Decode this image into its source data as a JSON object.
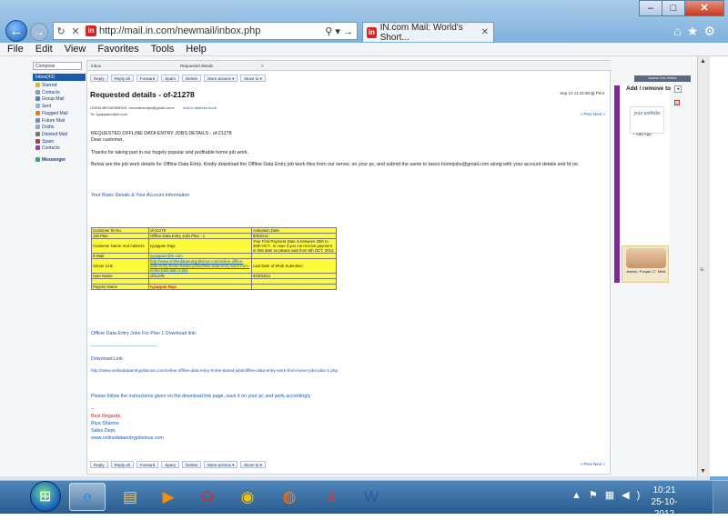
{
  "browser": {
    "url": "http://mail.in.com/newmail/inbox.php",
    "tab_title": "IN.com Mail: World's Short...",
    "menu": [
      "File",
      "Edit",
      "View",
      "Favorites",
      "Tools",
      "Help"
    ],
    "window_controls": [
      "–",
      "□",
      "✕"
    ]
  },
  "sidebar": {
    "compose": "Compose",
    "inbox": "Inbox(43)",
    "items": [
      "Starred",
      "Contacts",
      "Group Mail",
      "Sent",
      "Flagged Mail",
      "Future Mail",
      "Drafts",
      "Deleted Mail",
      "Spam",
      "Contacts",
      "Messenger"
    ]
  },
  "mail_tabs": {
    "inbox": "Inbox",
    "open_mail": "Requested details"
  },
  "toolbar": {
    "buttons": [
      "Reply",
      "Reply all",
      "Forward",
      "Spam",
      "Delete",
      "More actions ▾",
      "Move to ▾"
    ]
  },
  "mail": {
    "subject": "Requested details - of-21278",
    "date": "Sep 12 11:33:38",
    "print": "Print",
    "from": "ODEM-BRYADSBRUS <recruitmentpd@gmail.com>",
    "add_contact": "Add to address book",
    "to": "To: iyyappanrr@in.com",
    "prevnext": "« Prev  Next »",
    "heading": "REQUESTED OFFLINE DATA ENTRY JOBS DETAILS - of-21278",
    "greeting": "Dear customer,",
    "thanks": "Thanks for taking part in our hugely popular and profitable home job work.",
    "instructions": "Below are the job work details for Offline Data Entry. Kindly download the Offline Data Entry job work files from our server, on your pc, and submit the same to tasco.homejobs@gmail.com along with your account details and Id no.",
    "details_heading": "Your Basic Details & Your Account Information",
    "table": {
      "customer_id_label": "Customer ID No.",
      "customer_id": "of-21278",
      "activation_label": "Activation Date",
      "job_plan_label": "Job Plan",
      "job_plan": "Offline Data Entry Jobs Plan - 1",
      "activation_date": "8/5/2012",
      "name_label": "Customer Name And Address",
      "name": "Iyyappan Raja",
      "payment_note": "Your First Payment Date is between 25th to 30th OCT.. In case if you not receive payment in that date so please wait from 5th OCT. 2012",
      "email_label": "E-Mail",
      "email": "iyyappanr@in.com",
      "server_label": "Server Link",
      "server_link": "http://www.onlinedataentryjobsinus.com/online-offline-data-entry-home-based-jobs/offline-data-entry-work-from-home-jobs-plan-1.php",
      "last_date_label": "Last Date of Work Submition",
      "user_label": "User Name",
      "user_name": "of21278",
      "last_date": "8/20/2012",
      "payee_label": "Payees Name",
      "payee": "Iyyappan Raja"
    },
    "download_title": "Offline Data Entry Jobs For Plan 1 Download link:",
    "dashes": "-----------------------------------------",
    "download_label": "Download Link:",
    "download_url": "http://www.onlinedataentryjobsinus.com/online-offline-data-entry-home-based-jobs/offline-data-entry-work-from-home-jobs-plan-1.php",
    "follow": "Please follow the instructions given on the download link page, save it on your pc and work accordingly.",
    "sep": "--",
    "regards": "Best Regards,",
    "sig_name": "Riya Sharma",
    "sig_dept": "Sales Dept.",
    "sig_site": "www.onlinedataentryjobsinus.com"
  },
  "right_panel": {
    "top_button": "Access Your Hotline",
    "add_remove": "Add / remove to",
    "portfolio": "your portfolio",
    "add_app": "+ Add App",
    "ad_caption": "Ashish, Punjab 27, MBA"
  },
  "taskbar": {
    "time": "10:21",
    "date": "25-10-2012"
  }
}
